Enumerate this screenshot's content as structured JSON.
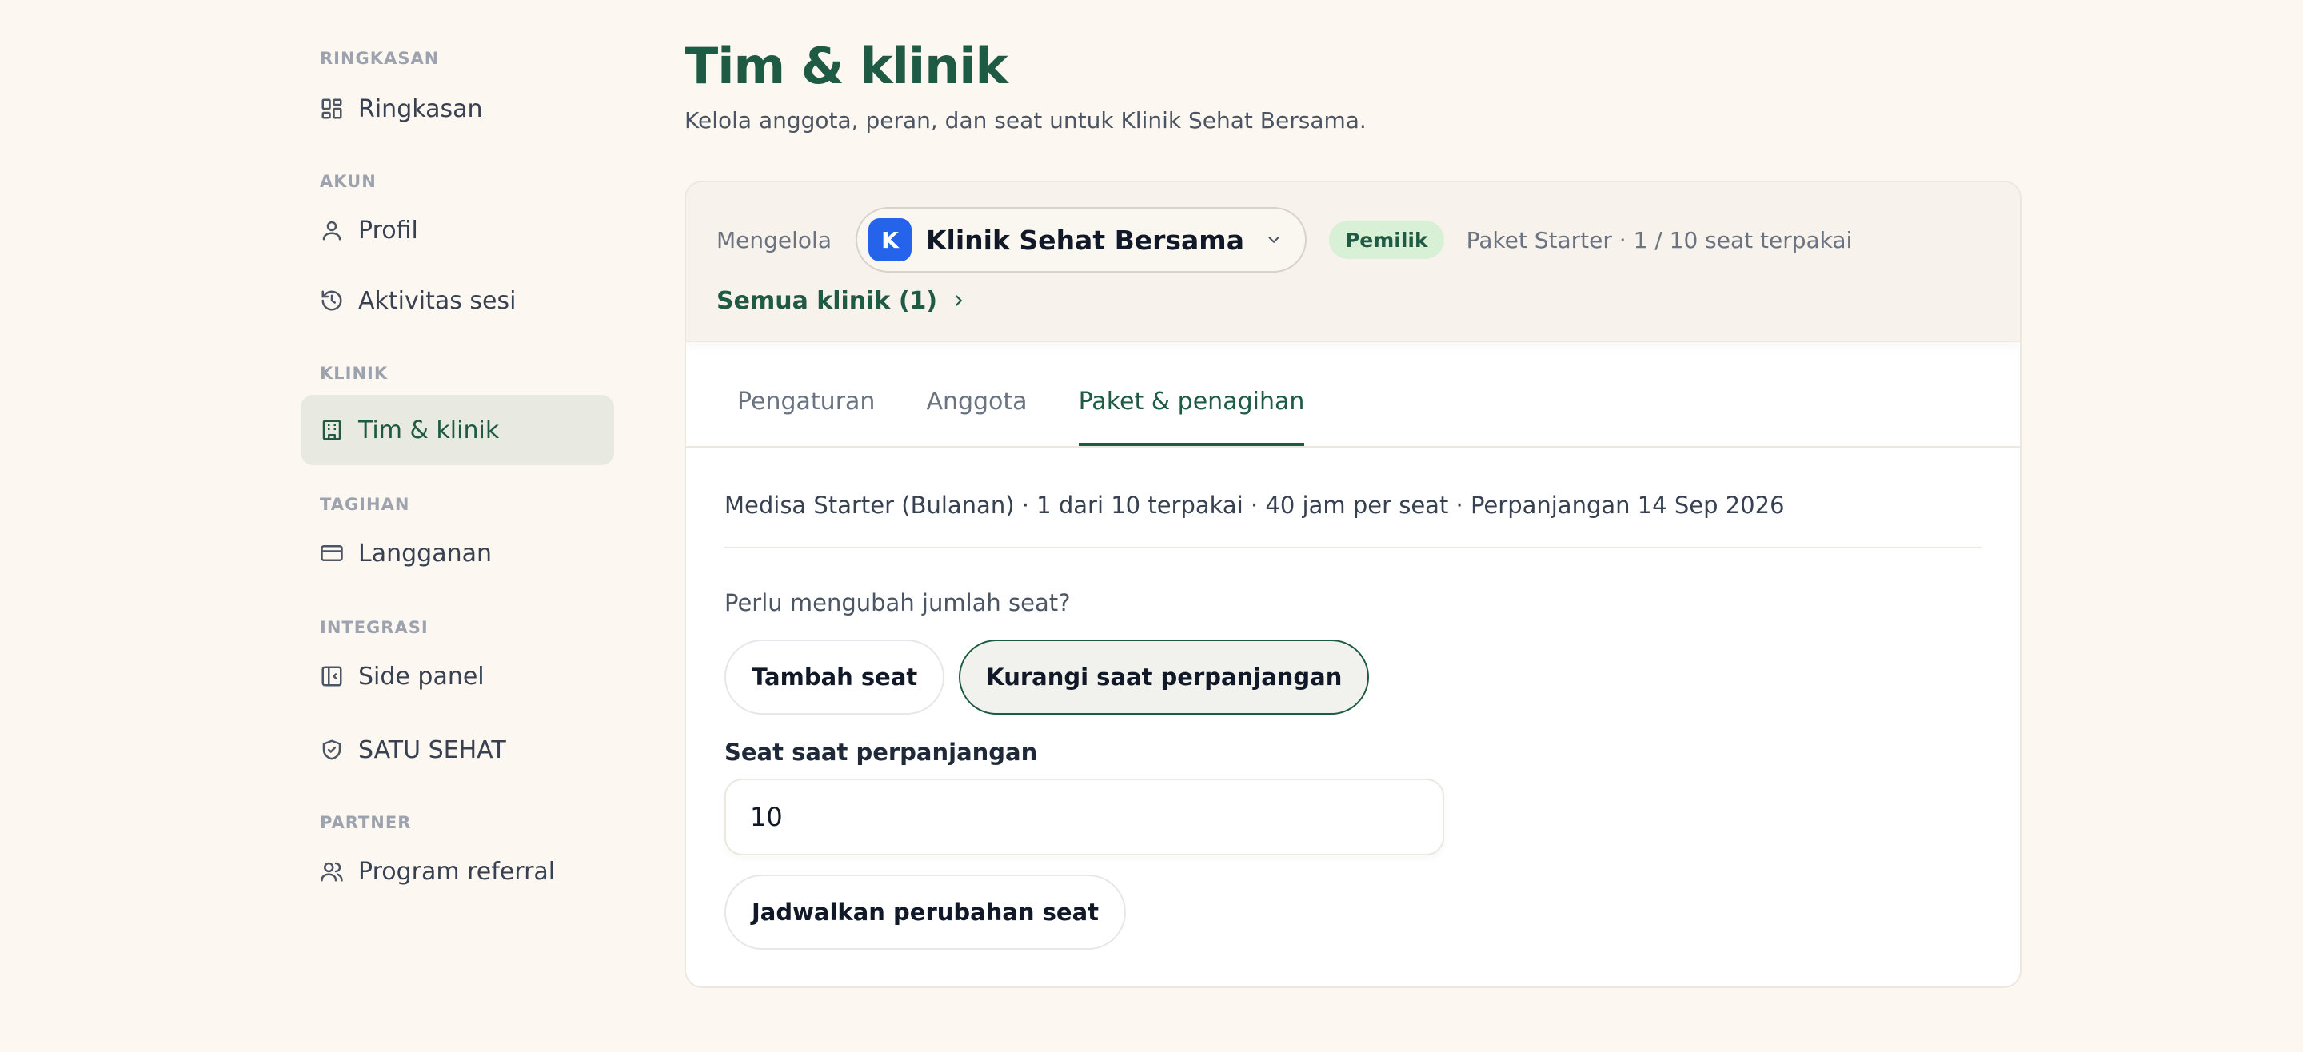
{
  "sidebar": {
    "sections": [
      {
        "label": "RINGKASAN",
        "items": [
          {
            "label": "Ringkasan",
            "icon": "dashboard-icon"
          }
        ]
      },
      {
        "label": "AKUN",
        "items": [
          {
            "label": "Profil",
            "icon": "user-icon"
          },
          {
            "label": "Aktivitas sesi",
            "icon": "history-icon"
          }
        ]
      },
      {
        "label": "KLINIK",
        "items": [
          {
            "label": "Tim & klinik",
            "icon": "building-icon",
            "active": true
          }
        ]
      },
      {
        "label": "TAGIHAN",
        "items": [
          {
            "label": "Langganan",
            "icon": "credit-card-icon"
          }
        ]
      },
      {
        "label": "INTEGRASI",
        "items": [
          {
            "label": "Side panel",
            "icon": "panel-icon"
          },
          {
            "label": "SATU SEHAT",
            "icon": "shield-check-icon"
          }
        ]
      },
      {
        "label": "PARTNER",
        "items": [
          {
            "label": "Program referral",
            "icon": "users-icon"
          }
        ]
      }
    ]
  },
  "header": {
    "title": "Tim & klinik",
    "subtitle": "Kelola anggota, peran, dan seat untuk Klinik Sehat Bersama."
  },
  "manage": {
    "label": "Mengelola",
    "clinic_initial": "K",
    "clinic_name": "Klinik Sehat Bersama",
    "role": "Pemilik",
    "plan": "Paket Starter · 1 / 10 seat terpakai",
    "all_clinics": "Semua klinik (1)"
  },
  "tabs": [
    {
      "label": "Pengaturan",
      "active": false
    },
    {
      "label": "Anggota",
      "active": false
    },
    {
      "label": "Paket & penagihan",
      "active": true
    }
  ],
  "billing": {
    "summary": "Medisa Starter (Bulanan) · 1 dari 10 terpakai · 40 jam per seat · Perpanjangan 14 Sep 2026",
    "question": "Perlu mengubah jumlah seat?",
    "add_seat": "Tambah seat",
    "reduce_on_renewal": "Kurangi saat perpanjangan",
    "seat_field_label": "Seat saat perpanjangan",
    "seat_field_value": "10",
    "schedule_button": "Jadwalkan perubahan seat"
  },
  "colors": {
    "brand": "#1f5a45",
    "background": "#fdf7f1",
    "avatar": "#2563eb",
    "badge": "#d7f0d6"
  }
}
